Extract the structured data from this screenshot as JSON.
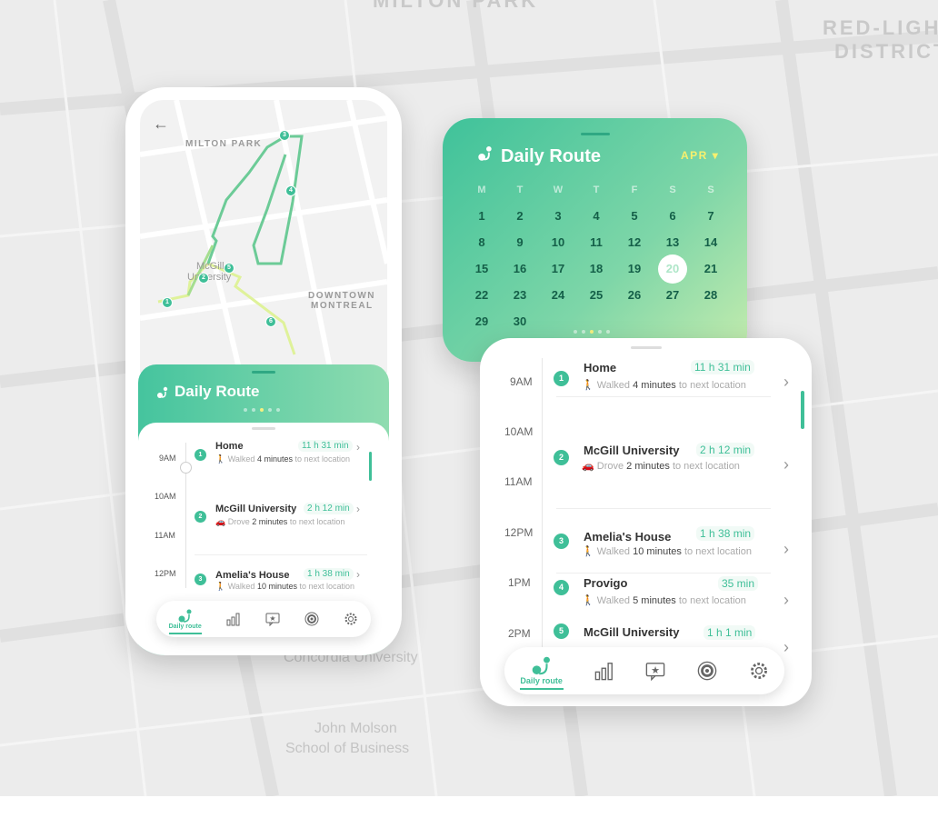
{
  "background": {
    "labels": [
      "MILTON PARK",
      "RED-LIGHT",
      "DISTRICT",
      "John Molson",
      "School of Business",
      "Concordia University"
    ]
  },
  "phone": {
    "back_icon": "back-arrow-icon",
    "map": {
      "labels": [
        "MILTON PARK",
        "DOWNTOWN",
        "MONTREAL",
        "McGill",
        "University"
      ],
      "pins": [
        "1",
        "2",
        "3",
        "4",
        "5",
        "6"
      ]
    },
    "sheet_title": "Daily Route",
    "timeline": {
      "times": [
        "9AM",
        "10AM",
        "11AM",
        "12PM"
      ],
      "entries": [
        {
          "num": "1",
          "name": "Home",
          "duration": "11 h 31 min",
          "verb": "Walked",
          "amount": "4 minutes",
          "suffix": "to next location"
        },
        {
          "num": "2",
          "name": "McGill University",
          "duration": "2 h 12 min",
          "verb": "Drove",
          "amount": "2 minutes",
          "suffix": "to next location"
        },
        {
          "num": "3",
          "name": "Amelia's House",
          "duration": "1 h 38 min",
          "verb": "Walked",
          "amount": "10 minutes",
          "suffix": "to next location"
        }
      ]
    },
    "nav": {
      "active_label": "Daily route"
    }
  },
  "calendar": {
    "title": "Daily Route",
    "month": "APR",
    "weekdays": [
      "M",
      "T",
      "W",
      "T",
      "F",
      "S",
      "S"
    ],
    "weeks": [
      [
        "1",
        "2",
        "3",
        "4",
        "5",
        "6",
        "7"
      ],
      [
        "8",
        "9",
        "10",
        "11",
        "12",
        "13",
        "14"
      ],
      [
        "15",
        "16",
        "17",
        "18",
        "19",
        "20",
        "21"
      ],
      [
        "22",
        "23",
        "24",
        "25",
        "26",
        "27",
        "28"
      ],
      [
        "29",
        "30",
        "",
        "",
        "",
        "",
        ""
      ]
    ],
    "selected": "20"
  },
  "list_card": {
    "times": [
      "9AM",
      "10AM",
      "11AM",
      "12PM",
      "1PM",
      "2PM"
    ],
    "entries": [
      {
        "num": "1",
        "name": "Home",
        "duration": "11 h 31 min",
        "verb": "Walked",
        "amount": "4 minutes",
        "suffix": "to next location"
      },
      {
        "num": "2",
        "name": "McGill University",
        "duration": "2 h 12 min",
        "verb": "Drove",
        "amount": "2 minutes",
        "suffix": "to next location"
      },
      {
        "num": "3",
        "name": "Amelia's House",
        "duration": "1 h 38 min",
        "verb": "Walked",
        "amount": "10 minutes",
        "suffix": "to next location"
      },
      {
        "num": "4",
        "name": "Provigo",
        "duration": "35 min",
        "verb": "Walked",
        "amount": "5 minutes",
        "suffix": "to next location"
      },
      {
        "num": "5",
        "name": "McGill University",
        "duration": "1 h 1 min",
        "verb": "",
        "amount": "",
        "suffix": ""
      }
    ],
    "nav": {
      "active_label": "Daily route"
    }
  },
  "colors": {
    "accent": "#3fbf98",
    "month": "#f7f06e",
    "route_light": "#dff29a"
  }
}
